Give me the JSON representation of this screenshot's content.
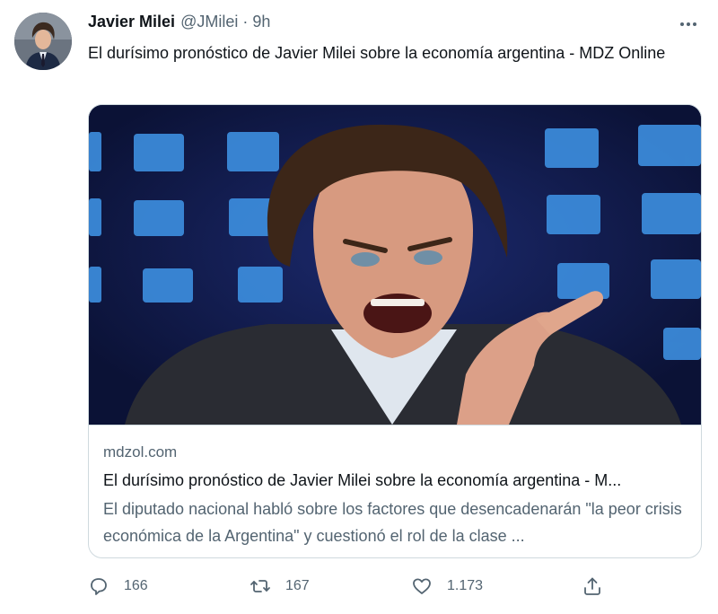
{
  "author": {
    "name": "Javier Milei",
    "handle": "@JMilei",
    "separator": "·",
    "time": "9h"
  },
  "tweet": {
    "text": "El durísimo pronóstico de Javier Milei sobre la economía argentina - MDZ Online"
  },
  "card": {
    "domain": "mdzol.com",
    "title": "El durísimo pronóstico de Javier Milei sobre la economía argentina - M...",
    "description": "El diputado nacional habló sobre los factores que desencadenarán \"la peor crisis económica de la Argentina\" y cuestionó el rol de la clase ..."
  },
  "actions": {
    "replies": "166",
    "retweets": "167",
    "likes": "1.173"
  },
  "icons": {
    "more": "more-icon",
    "reply": "reply-icon",
    "retweet": "retweet-icon",
    "like": "heart-icon",
    "share": "share-icon"
  },
  "colors": {
    "text": "#0f1419",
    "secondary": "#536471",
    "border": "#cfd9de"
  }
}
